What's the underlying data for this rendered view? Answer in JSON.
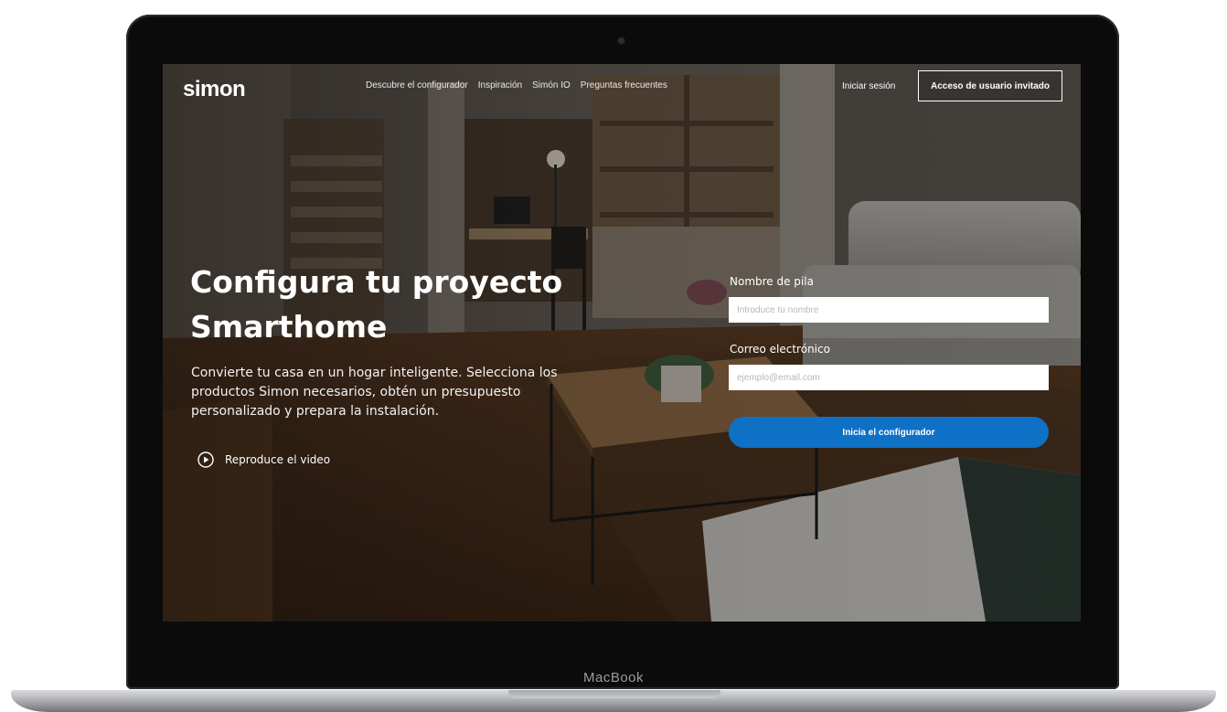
{
  "device": {
    "chin_label": "MacBook"
  },
  "nav": {
    "logo": "simon",
    "links": [
      "Descubre el configurador",
      "Inspiración",
      "Simón IO",
      "Preguntas frecuentes"
    ],
    "login_label": "Iniciar sesión",
    "guest_button_label": "Acceso de usuario invitado"
  },
  "hero": {
    "title": "Configura tu proyecto Smarthome",
    "description": "Convierte tu casa en un hogar inteligente. Selecciona los productos Simon necesarios, obtén un presupuesto personalizado y prepara la instalación.",
    "video_link_label": "Reproduce el video"
  },
  "form": {
    "name_label": "Nombre de pila",
    "name_placeholder": "Introduce tu nombre",
    "name_value": "",
    "email_label": "Correo electrónico",
    "email_placeholder": "ejemplo@email.com",
    "email_value": "",
    "submit_label": "Inicia el configurador"
  },
  "colors": {
    "accent": "#0f71c6",
    "laptop_bezel": "#0b0b0c"
  },
  "icons": {
    "play": "play-circle-icon",
    "camera": "camera-icon"
  }
}
